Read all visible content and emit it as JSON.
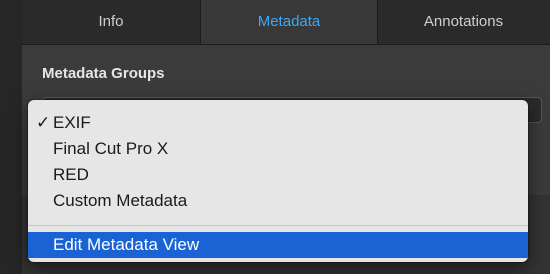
{
  "tabs": [
    {
      "label": "Info"
    },
    {
      "label": "Metadata",
      "selected": true
    },
    {
      "label": "Annotations"
    }
  ],
  "section": {
    "title": "Metadata Groups"
  },
  "menu": {
    "checkmark": "✓",
    "items": [
      {
        "label": "EXIF",
        "checked": true
      },
      {
        "label": "Final Cut Pro X"
      },
      {
        "label": "RED"
      },
      {
        "label": "Custom Metadata"
      }
    ],
    "action": {
      "label": "Edit Metadata View",
      "highlighted": true
    }
  },
  "colors": {
    "selected_tab_text": "#3fa8f5",
    "menu_highlight": "#1a63d4"
  }
}
